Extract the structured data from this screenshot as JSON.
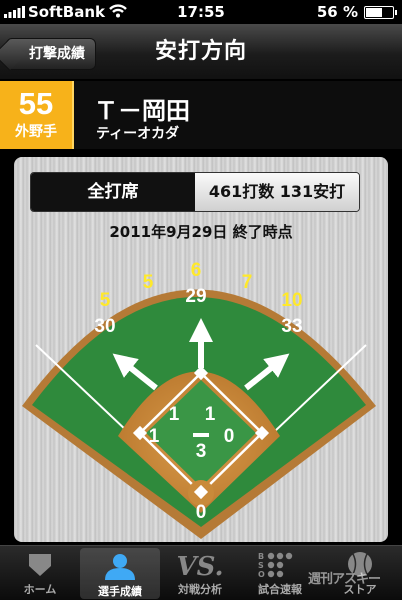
{
  "status": {
    "carrier": "SoftBank",
    "time": "17:55",
    "battery_percent": "56 %",
    "battery_level": 0.56
  },
  "nav": {
    "back_label": "打撃成績",
    "title": "安打方向"
  },
  "player": {
    "number": "55",
    "position": "外野手",
    "name": "Ｔ－岡田",
    "kana": "ティーオカダ"
  },
  "summary": {
    "filter_label": "全打席",
    "stats": "461打数 131安打"
  },
  "date": "2011年9月29日 終了時点",
  "field": {
    "outfield": {
      "left": {
        "hits": "5",
        "at_bats": "30"
      },
      "left_center": {
        "hits": "5"
      },
      "center": {
        "hits": "6",
        "at_bats": "29"
      },
      "right_center": {
        "hits": "7"
      },
      "right": {
        "hits": "10",
        "at_bats": "33"
      }
    },
    "infield": {
      "third": "1",
      "short": "1",
      "second": "1",
      "first": "0",
      "pitcher": "3",
      "catcher": "0"
    },
    "colors": {
      "grass": "#2f8a3c",
      "dirt": "#c98a3a",
      "hits": "#ffe92a",
      "at_bats": "#ffffff"
    }
  },
  "tabbar": {
    "items": [
      {
        "label": "ホーム",
        "icon": "home-plate-icon"
      },
      {
        "label": "選手成績",
        "icon": "player-icon",
        "active": true
      },
      {
        "label": "対戦分析",
        "icon": "vs-icon"
      },
      {
        "label": "試合速報",
        "icon": "scoreboard-icon"
      },
      {
        "label": "ストア",
        "icon": "baseball-icon"
      }
    ],
    "watermark": "週刊アスキー"
  }
}
